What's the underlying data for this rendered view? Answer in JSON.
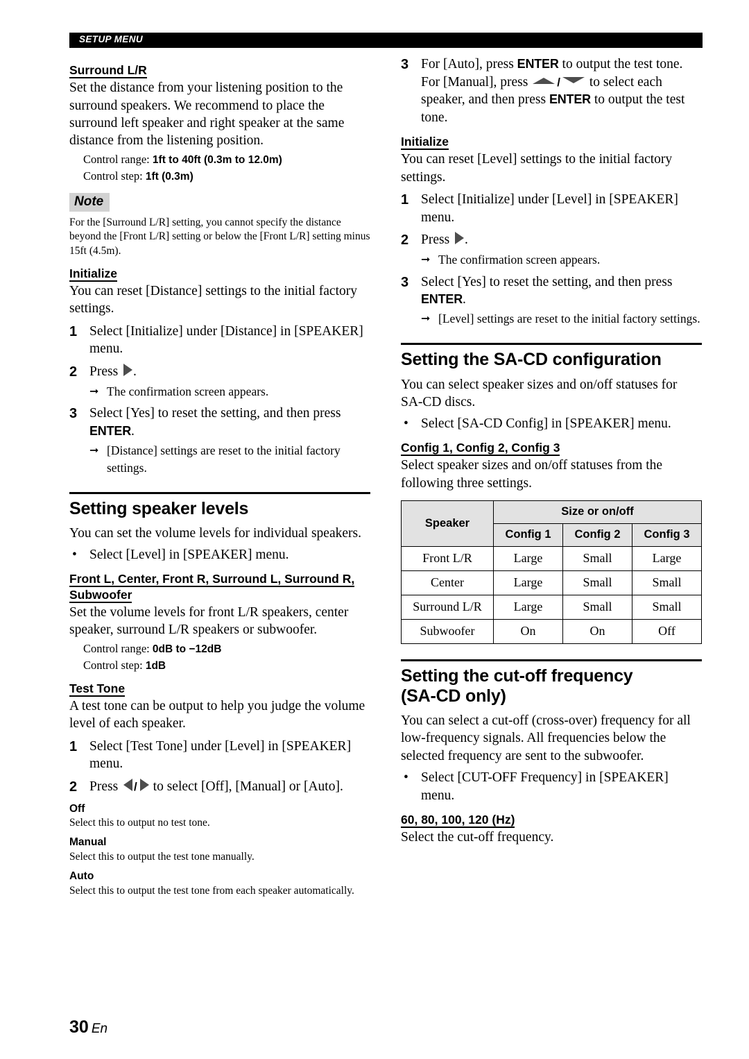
{
  "header": {
    "running_head": "SETUP MENU"
  },
  "left_column": {
    "surround": {
      "heading": "Surround L/R",
      "body": "Set the distance from your listening position to the surround speakers. We recommend to place the surround left speaker and right speaker at the same distance from the listening position.",
      "control_range_label": "Control range: ",
      "control_range_value": "1ft to 40ft (0.3m to 12.0m)",
      "control_step_label": "Control step: ",
      "control_step_value": "1ft (0.3m)"
    },
    "note": {
      "tag": "Note",
      "body": "For the [Surround L/R] setting, you cannot specify the distance beyond the [Front L/R] setting or below the [Front L/R] setting minus 15ft (4.5m)."
    },
    "initialize": {
      "heading": "Initialize",
      "body": "You can reset [Distance] settings to the initial factory settings.",
      "steps": [
        {
          "num": "1",
          "text": "Select [Initialize] under [Distance] in [SPEAKER] menu."
        },
        {
          "num": "2",
          "text_before": "Press ",
          "text_after": "."
        },
        {
          "num": "3",
          "text_before": "Select [Yes] to reset the setting, and then press ",
          "bold": "ENTER",
          "text_after": "."
        }
      ],
      "result_step2": "The confirmation screen appears.",
      "result_step3": "[Distance] settings are reset to the initial factory settings."
    },
    "speaker_levels": {
      "heading": "Setting speaker levels",
      "body": "You can set the volume levels for individual speakers.",
      "bullet": "Select [Level] in [SPEAKER] menu."
    },
    "channels": {
      "heading_line1": "Front L, Center, Front R, Surround L, Surround R,",
      "heading_line2": "Subwoofer",
      "body": "Set the volume levels for front L/R speakers, center speaker, surround L/R speakers or subwoofer.",
      "control_range_label": "Control range: ",
      "control_range_value": "0dB to −12dB",
      "control_step_label": "Control step: ",
      "control_step_value": "1dB"
    },
    "test_tone": {
      "heading": "Test Tone",
      "body": "A test tone can be output to help you judge the volume level of each speaker.",
      "step1_num": "1",
      "step1_text": "Select [Test Tone] under [Level] in [SPEAKER] menu.",
      "step2_num": "2",
      "step2_before": "Press ",
      "step2_after": " to select [Off], [Manual] or [Auto].",
      "options": [
        {
          "label": "Off",
          "desc": "Select this to output no test tone."
        },
        {
          "label": "Manual",
          "desc": "Select this to output the test tone manually."
        },
        {
          "label": "Auto",
          "desc": "Select this to output the test tone from each speaker automatically."
        }
      ]
    }
  },
  "right_column": {
    "test_tone_step3": {
      "num": "3",
      "part1": "For [Auto], press ",
      "bold1": "ENTER",
      "part2": " to output the test tone. For [Manual], press ",
      "part3": " to select each speaker, and then press ",
      "bold2": "ENTER",
      "part4": " to output the test tone."
    },
    "initialize": {
      "heading": "Initialize",
      "body": "You can reset [Level] settings to the initial factory settings.",
      "step1_num": "1",
      "step1_text": "Select [Initialize] under [Level] in [SPEAKER] menu.",
      "step2_num": "2",
      "step2_before": "Press ",
      "step2_after": ".",
      "result_step2": "The confirmation screen appears.",
      "step3_num": "3",
      "step3_before": "Select [Yes] to reset the setting, and then press ",
      "step3_bold": "ENTER",
      "step3_after": ".",
      "result_step3": "[Level] settings are reset to the initial factory settings."
    },
    "sacd_config": {
      "heading": "Setting the SA-CD configuration",
      "body": "You can select speaker sizes and on/off statuses for SA-CD discs.",
      "bullet": "Select [SA-CD Config] in [SPEAKER] menu.",
      "sub_heading": "Config 1, Config 2, Config 3",
      "sub_body": "Select speaker sizes and on/off statuses from the following three settings."
    },
    "config_table": {
      "col_speaker": "Speaker",
      "group_header": "Size or on/off",
      "config_headers": [
        "Config 1",
        "Config 2",
        "Config 3"
      ],
      "rows": [
        {
          "speaker": "Front L/R",
          "values": [
            "Large",
            "Small",
            "Large"
          ]
        },
        {
          "speaker": "Center",
          "values": [
            "Large",
            "Small",
            "Small"
          ]
        },
        {
          "speaker": "Surround L/R",
          "values": [
            "Large",
            "Small",
            "Small"
          ]
        },
        {
          "speaker": "Subwoofer",
          "values": [
            "On",
            "On",
            "Off"
          ]
        }
      ]
    },
    "cutoff": {
      "heading_line1": "Setting the cut-off frequency",
      "heading_line2": "(SA-CD only)",
      "body": "You can select a cut-off (cross-over) frequency for all low-frequency signals. All frequencies below the selected frequency are sent to the subwoofer.",
      "bullet": "Select [CUT-OFF Frequency] in [SPEAKER] menu.",
      "sub_heading": "60, 80, 100, 120 (Hz)",
      "sub_body": "Select the cut-off frequency."
    }
  },
  "footer": {
    "page_number": "30",
    "language": "En"
  }
}
